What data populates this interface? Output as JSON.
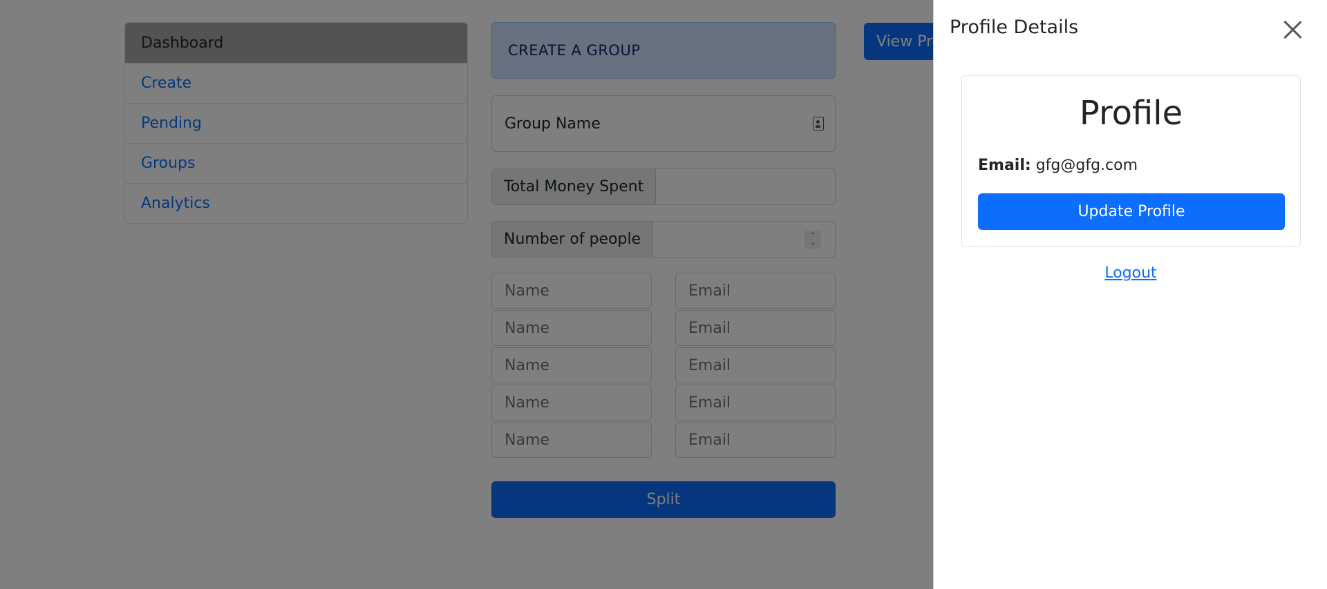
{
  "sidebar": {
    "items": [
      {
        "label": "Dashboard"
      },
      {
        "label": "Create"
      },
      {
        "label": "Pending"
      },
      {
        "label": "Groups"
      },
      {
        "label": "Analytics"
      }
    ]
  },
  "form": {
    "header": "CREATE A GROUP",
    "group_name_placeholder": "Group Name",
    "total_money_label": "Total Money Spent",
    "total_money_value": "",
    "people_label": "Number of people",
    "people_value": "",
    "members": [
      {
        "name_placeholder": "Name",
        "email_placeholder": "Email"
      },
      {
        "name_placeholder": "Name",
        "email_placeholder": "Email"
      },
      {
        "name_placeholder": "Name",
        "email_placeholder": "Email"
      },
      {
        "name_placeholder": "Name",
        "email_placeholder": "Email"
      },
      {
        "name_placeholder": "Name",
        "email_placeholder": "Email"
      }
    ],
    "split_label": "Split"
  },
  "view_profile_label": "View Profile",
  "offcanvas": {
    "title": "Profile Details",
    "card_heading": "Profile",
    "email_label": "Email:",
    "email_value": "gfg@gfg.com",
    "update_label": "Update Profile",
    "logout_label": "Logout"
  },
  "colors": {
    "primary": "#0d6efd",
    "header_bg": "#cfe2ff",
    "active_item_bg": "#a6a6a6",
    "backdrop": "rgba(0,0,0,0.5)"
  },
  "icons": {
    "group_name_field": "contact-card-icon",
    "close": "close-icon",
    "spinner": "spinner-arrows-icon"
  }
}
